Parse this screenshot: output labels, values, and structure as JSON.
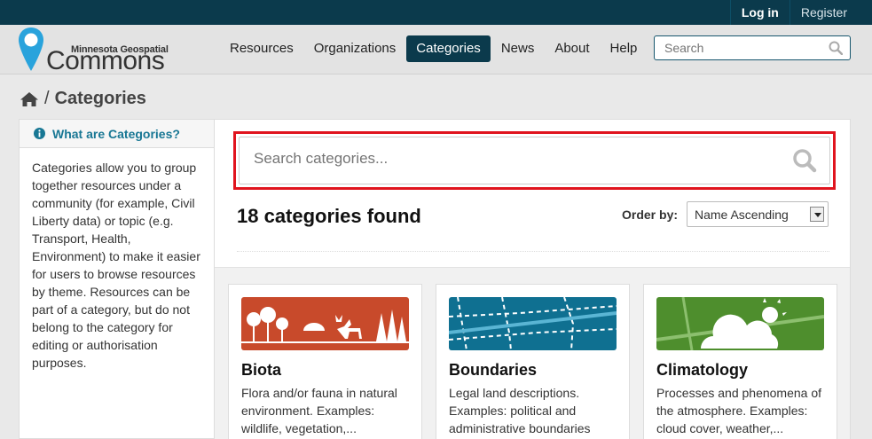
{
  "topbar": {
    "login": "Log in",
    "register": "Register"
  },
  "logo": {
    "small": "Minnesota Geospatial",
    "big": "Commons"
  },
  "nav": [
    {
      "label": "Resources",
      "active": false
    },
    {
      "label": "Organizations",
      "active": false
    },
    {
      "label": "Categories",
      "active": true
    },
    {
      "label": "News",
      "active": false
    },
    {
      "label": "About",
      "active": false
    },
    {
      "label": "Help",
      "active": false
    }
  ],
  "header_search": {
    "placeholder": "Search"
  },
  "breadcrumb": {
    "home_icon": "home-icon",
    "sep": "/",
    "current": "Categories"
  },
  "sidebar": {
    "title": "What are Categories?",
    "body": "Categories allow you to group together resources under a community (for example, Civil Liberty data) or topic (e.g. Transport, Health, Environment) to make it easier for users to browse resources by theme. Resources can be part of a category, but do not belong to the category for editing or authorisation purposes."
  },
  "category_search": {
    "placeholder": "Search categories..."
  },
  "results": {
    "count_text": "18 categories found"
  },
  "order": {
    "label": "Order by:",
    "selected": "Name Ascending"
  },
  "cards": [
    {
      "title": "Biota",
      "desc": "Flora and/or fauna in natural environment. Examples: wildlife, vegetation,...",
      "color": "#c84a2b"
    },
    {
      "title": "Boundaries",
      "desc": "Legal land descriptions. Examples: political and administrative boundaries",
      "color": "#0f7091"
    },
    {
      "title": "Climatology",
      "desc": "Processes and phenomena of the atmosphere. Examples: cloud cover, weather,...",
      "color": "#4e8e2d"
    }
  ],
  "colors": {
    "topbar": "#0b3a4c",
    "accent": "#0b3a4c",
    "highlight": "#e0141e",
    "link": "#187794",
    "logo_pin": "#29a3dc"
  }
}
